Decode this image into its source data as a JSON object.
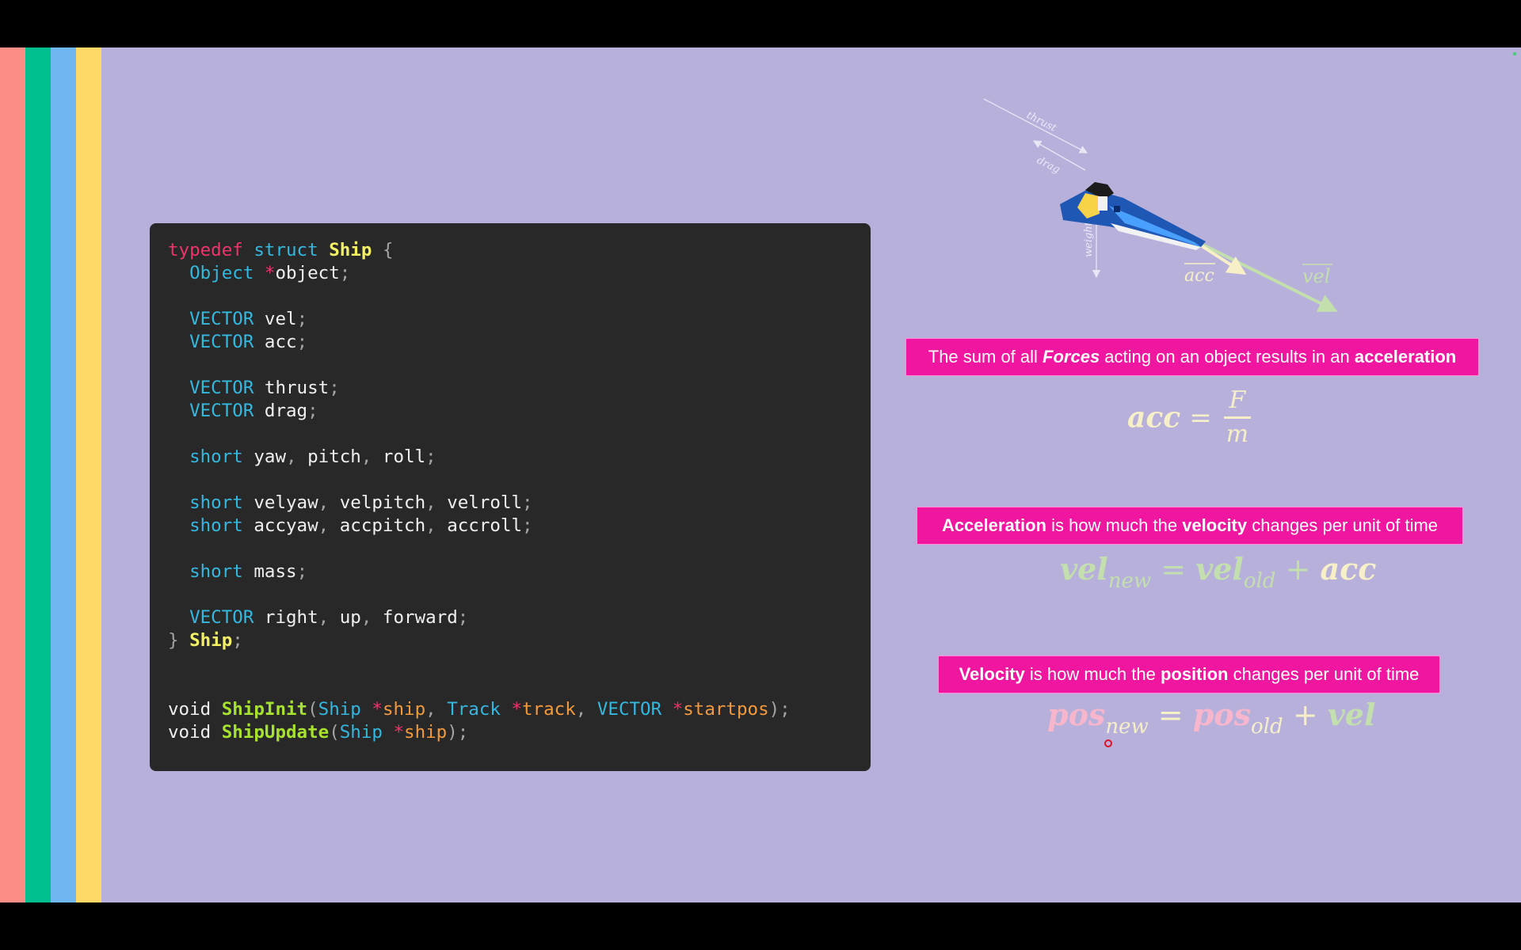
{
  "code": {
    "lines": [
      {
        "tokens": [
          {
            "t": "typedef",
            "c": "kw"
          },
          {
            "t": " "
          },
          {
            "t": "struct",
            "c": "ty"
          },
          {
            "t": " "
          },
          {
            "t": "Ship",
            "c": "id"
          },
          {
            "t": " "
          },
          {
            "t": "{",
            "c": "pu"
          }
        ]
      },
      {
        "tokens": [
          {
            "t": "  "
          },
          {
            "t": "Object",
            "c": "ty"
          },
          {
            "t": " "
          },
          {
            "t": "*",
            "c": "op"
          },
          {
            "t": "object"
          },
          {
            "t": ";",
            "c": "pu"
          }
        ]
      },
      {
        "tokens": []
      },
      {
        "tokens": [
          {
            "t": "  "
          },
          {
            "t": "VECTOR",
            "c": "ty"
          },
          {
            "t": " vel"
          },
          {
            "t": ";",
            "c": "pu"
          }
        ]
      },
      {
        "tokens": [
          {
            "t": "  "
          },
          {
            "t": "VECTOR",
            "c": "ty"
          },
          {
            "t": " acc"
          },
          {
            "t": ";",
            "c": "pu"
          }
        ]
      },
      {
        "tokens": []
      },
      {
        "tokens": [
          {
            "t": "  "
          },
          {
            "t": "VECTOR",
            "c": "ty"
          },
          {
            "t": " thrust"
          },
          {
            "t": ";",
            "c": "pu"
          }
        ]
      },
      {
        "tokens": [
          {
            "t": "  "
          },
          {
            "t": "VECTOR",
            "c": "ty"
          },
          {
            "t": " drag"
          },
          {
            "t": ";",
            "c": "pu"
          }
        ]
      },
      {
        "tokens": []
      },
      {
        "tokens": [
          {
            "t": "  "
          },
          {
            "t": "short",
            "c": "ty"
          },
          {
            "t": " yaw"
          },
          {
            "t": ",",
            "c": "pu"
          },
          {
            "t": " pitch"
          },
          {
            "t": ",",
            "c": "pu"
          },
          {
            "t": " roll"
          },
          {
            "t": ";",
            "c": "pu"
          }
        ]
      },
      {
        "tokens": []
      },
      {
        "tokens": [
          {
            "t": "  "
          },
          {
            "t": "short",
            "c": "ty"
          },
          {
            "t": " velyaw"
          },
          {
            "t": ",",
            "c": "pu"
          },
          {
            "t": " velpitch"
          },
          {
            "t": ",",
            "c": "pu"
          },
          {
            "t": " velroll"
          },
          {
            "t": ";",
            "c": "pu"
          }
        ]
      },
      {
        "tokens": [
          {
            "t": "  "
          },
          {
            "t": "short",
            "c": "ty"
          },
          {
            "t": " accyaw"
          },
          {
            "t": ",",
            "c": "pu"
          },
          {
            "t": " accpitch"
          },
          {
            "t": ",",
            "c": "pu"
          },
          {
            "t": " accroll"
          },
          {
            "t": ";",
            "c": "pu"
          }
        ]
      },
      {
        "tokens": []
      },
      {
        "tokens": [
          {
            "t": "  "
          },
          {
            "t": "short",
            "c": "ty"
          },
          {
            "t": " mass"
          },
          {
            "t": ";",
            "c": "pu"
          }
        ]
      },
      {
        "tokens": []
      },
      {
        "tokens": [
          {
            "t": "  "
          },
          {
            "t": "VECTOR",
            "c": "ty"
          },
          {
            "t": " right"
          },
          {
            "t": ",",
            "c": "pu"
          },
          {
            "t": " up"
          },
          {
            "t": ",",
            "c": "pu"
          },
          {
            "t": " forward"
          },
          {
            "t": ";",
            "c": "pu"
          }
        ]
      },
      {
        "tokens": [
          {
            "t": "}",
            "c": "pu"
          },
          {
            "t": " "
          },
          {
            "t": "Ship",
            "c": "id"
          },
          {
            "t": ";",
            "c": "pu"
          }
        ]
      },
      {
        "tokens": []
      },
      {
        "tokens": []
      },
      {
        "tokens": [
          {
            "t": "void "
          },
          {
            "t": "ShipInit",
            "c": "fn"
          },
          {
            "t": "(",
            "c": "pu"
          },
          {
            "t": "Ship",
            "c": "ty"
          },
          {
            "t": " "
          },
          {
            "t": "*",
            "c": "op"
          },
          {
            "t": "ship",
            "c": "pa"
          },
          {
            "t": ",",
            "c": "pu"
          },
          {
            "t": " "
          },
          {
            "t": "Track",
            "c": "ty"
          },
          {
            "t": " "
          },
          {
            "t": "*",
            "c": "op"
          },
          {
            "t": "track",
            "c": "pa"
          },
          {
            "t": ",",
            "c": "pu"
          },
          {
            "t": " "
          },
          {
            "t": "VECTOR",
            "c": "ty"
          },
          {
            "t": " "
          },
          {
            "t": "*",
            "c": "op"
          },
          {
            "t": "startpos",
            "c": "pa"
          },
          {
            "t": ");",
            "c": "pu"
          }
        ]
      },
      {
        "tokens": [
          {
            "t": "void "
          },
          {
            "t": "ShipUpdate",
            "c": "fn"
          },
          {
            "t": "(",
            "c": "pu"
          },
          {
            "t": "Ship",
            "c": "ty"
          },
          {
            "t": " "
          },
          {
            "t": "*",
            "c": "op"
          },
          {
            "t": "ship",
            "c": "pa"
          },
          {
            "t": ");",
            "c": "pu"
          }
        ]
      }
    ]
  },
  "diagram": {
    "thrust_label": "thrust",
    "drag_label": "drag",
    "weight_label": "weight",
    "acc_label": "acc",
    "vel_label": "vel"
  },
  "facts": {
    "forces": {
      "pre": "The sum of all ",
      "em1": "Forces",
      "mid": " acting on an object results in an ",
      "em2": "acceleration",
      "post": ""
    },
    "acceleration": {
      "pre": "",
      "em1": "Acceleration",
      "mid": " is how much the ",
      "em2": "velocity",
      "post": " changes per unit of time"
    },
    "velocity": {
      "pre": "",
      "em1": "Velocity",
      "mid": " is how much the ",
      "em2": "position",
      "post": " changes per unit of time"
    }
  },
  "formulas": {
    "f1": {
      "lhs": "acc",
      "eq": "=",
      "num": "F",
      "den": "m"
    },
    "f2": {
      "a": "vel",
      "a_sub": "new",
      "eq": "=",
      "b": "vel",
      "b_sub": "old",
      "plus": "+",
      "c": "acc"
    },
    "f3": {
      "a": "pos",
      "a_sub": "new",
      "eq": "=",
      "b": "pos",
      "b_sub": "old",
      "plus": "+",
      "c": "vel"
    }
  },
  "colors": {
    "slide_bg": "#b6b0da",
    "banner": "#f0169f",
    "code_bg": "#282828",
    "stripes": [
      "#fc8c86",
      "#00c090",
      "#70b6f0",
      "#ffd868"
    ]
  }
}
